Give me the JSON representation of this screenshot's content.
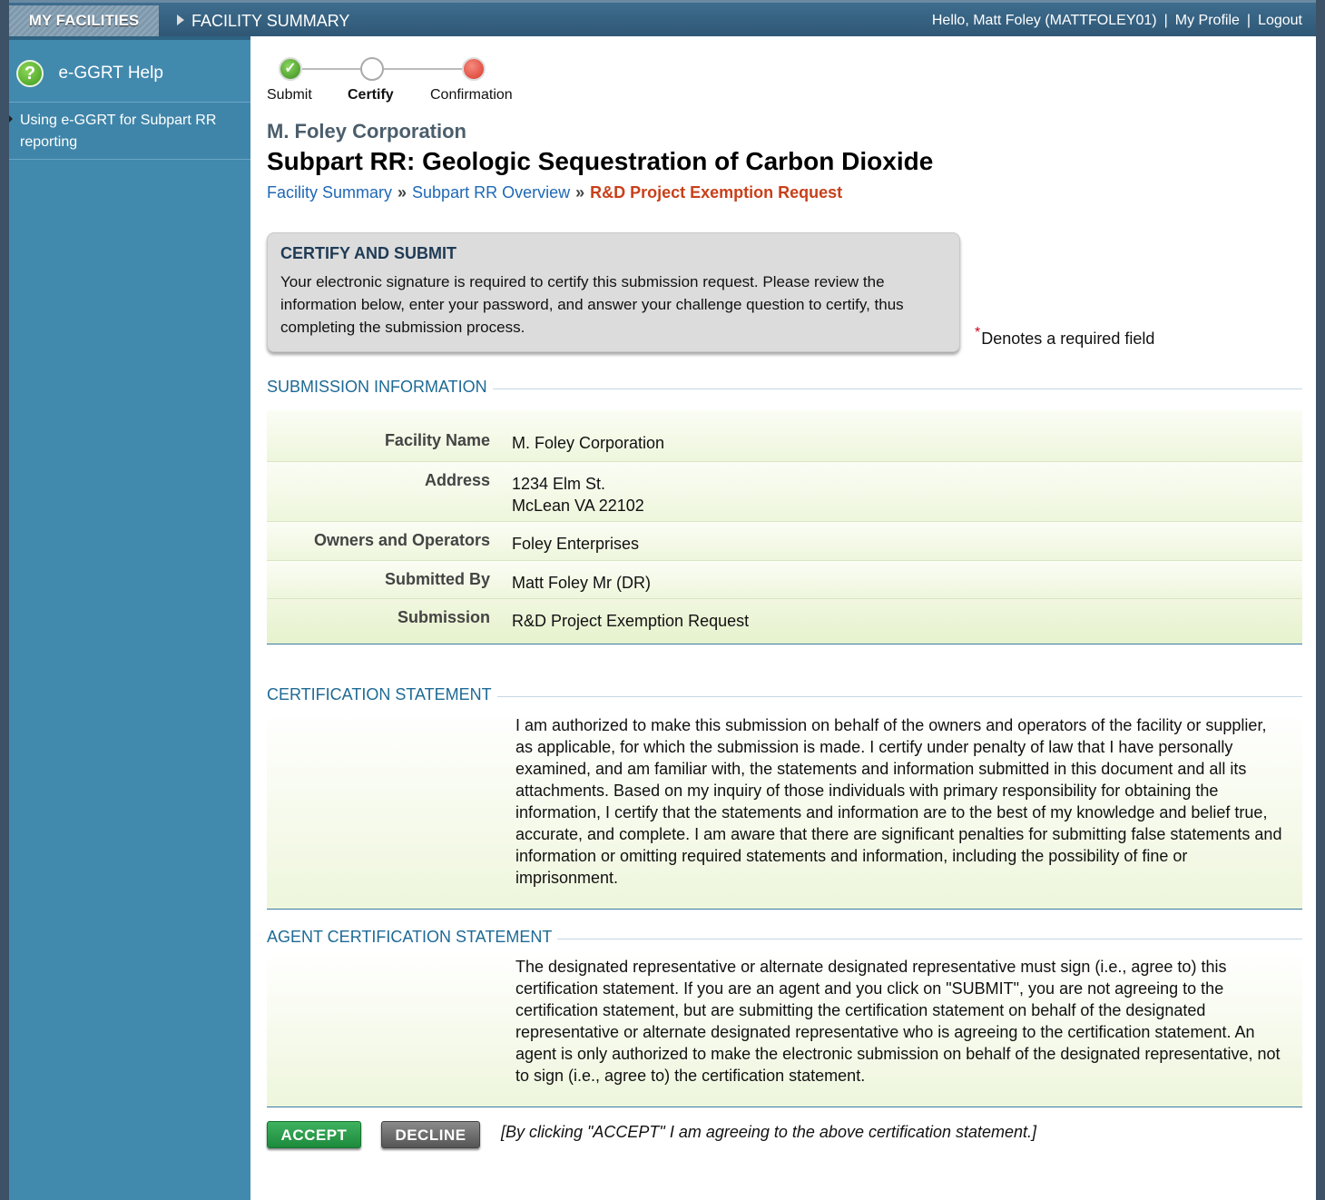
{
  "topbar": {
    "tab_my_facilities": "MY FACILITIES",
    "tab_facility_summary": "FACILITY SUMMARY",
    "greeting": "Hello, Matt Foley (MATTFOLEY01)",
    "sep": "|",
    "my_profile": "My Profile",
    "logout": "Logout"
  },
  "sidebar": {
    "help_title": "e-GGRT Help",
    "help_icon": "?",
    "help_link": "Using e-GGRT for Subpart RR reporting"
  },
  "steps": [
    {
      "label": "Submit",
      "state": "done"
    },
    {
      "label": "Certify",
      "state": "current"
    },
    {
      "label": "Confirmation",
      "state": "pending"
    }
  ],
  "check_glyph": "✓",
  "company": "M. Foley Corporation",
  "page_title": "Subpart RR: Geologic Sequestration of Carbon Dioxide",
  "breadcrumb": {
    "item1": "Facility Summary",
    "item2": "Subpart RR Overview",
    "sep": "»",
    "current": "R&D Project Exemption Request"
  },
  "notice": {
    "title": "CERTIFY AND SUBMIT",
    "body": "Your electronic signature is required to certify this submission request. Please review the information below, enter your password, and answer your challenge question to certify, thus completing the submission process."
  },
  "required_note": {
    "star": "*",
    "text": "Denotes a required field"
  },
  "submission_info": {
    "heading": "SUBMISSION INFORMATION",
    "facility_name_label": "Facility Name",
    "facility_name": "M. Foley Corporation",
    "address_label": "Address",
    "address_line1": "1234 Elm St.",
    "address_line2": "McLean VA 22102",
    "owners_label": "Owners and Operators",
    "owners": "Foley Enterprises",
    "submitted_by_label": "Submitted By",
    "submitted_by": "Matt Foley Mr (DR)",
    "submission_label": "Submission",
    "submission": "R&D Project Exemption Request"
  },
  "certification": {
    "heading": "CERTIFICATION STATEMENT",
    "text": "I am authorized to make this submission on behalf of the owners and operators of the facility or supplier, as applicable, for which the submission is made. I certify under penalty of law that I have personally examined, and am familiar with, the statements and information submitted in this document and all its attachments. Based on my inquiry of those individuals with primary responsibility for obtaining the information, I certify that the statements and information are to the best of my knowledge and belief true, accurate, and complete. I am aware that there are significant penalties for submitting false statements and information or omitting required statements and information, including the possibility of fine or imprisonment."
  },
  "agent_certification": {
    "heading": "AGENT CERTIFICATION STATEMENT",
    "text": "The designated representative or alternate designated representative must sign (i.e., agree to) this certification statement. If you are an agent and you click on \"SUBMIT\", you are not agreeing to the certification statement, but are submitting the certification statement on behalf of the designated representative or alternate designated representative who is agreeing to the certification statement. An agent is only authorized to make the electronic submission on behalf of the designated representative, not to sign (i.e., agree to) the certification statement."
  },
  "actions": {
    "accept": "ACCEPT",
    "decline": "DECLINE",
    "note": "[By clicking \"ACCEPT\" I am agreeing to the above certification statement.]"
  }
}
